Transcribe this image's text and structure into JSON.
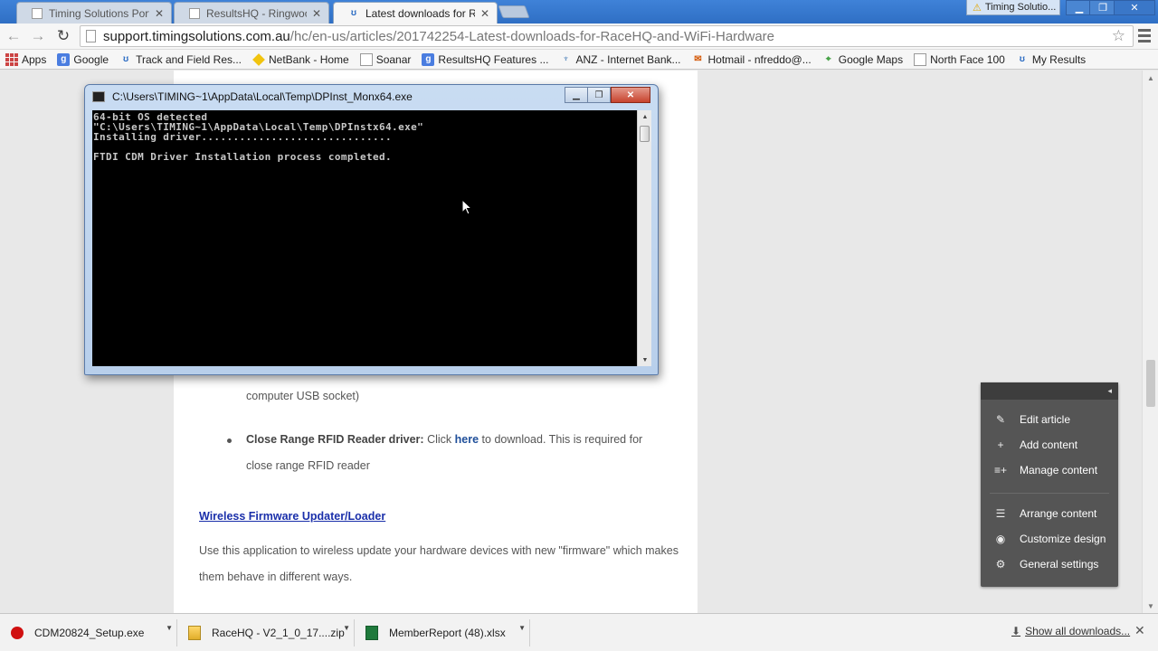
{
  "tabs": [
    {
      "title": "Timing Solutions Portal | L",
      "active": false
    },
    {
      "title": "ResultsHQ - Ringwood LA",
      "active": false
    },
    {
      "title": "Latest downloads for Race",
      "active": true
    }
  ],
  "profile_badge": "Timing Solutio...",
  "window_controls": {
    "minimize": "▁",
    "restore": "❐",
    "close": "✕"
  },
  "toolbar": {
    "url_host": "support.timingsolutions.com.au",
    "url_path": "/hc/en-us/articles/201742254-Latest-downloads-for-RaceHQ-and-WiFi-Hardware"
  },
  "bookmarks": [
    {
      "label": "Apps",
      "icon": "apps-icon"
    },
    {
      "label": "Google",
      "icon": "google-icon"
    },
    {
      "label": "Track and Field Res...",
      "icon": "u-icon"
    },
    {
      "label": "NetBank - Home",
      "icon": "netbank-icon"
    },
    {
      "label": "Soanar",
      "icon": "doc-icon"
    },
    {
      "label": "ResultsHQ Features ...",
      "icon": "google-icon"
    },
    {
      "label": "ANZ - Internet Bank...",
      "icon": "anz-icon"
    },
    {
      "label": "Hotmail - nfreddo@...",
      "icon": "hotmail-icon"
    },
    {
      "label": "Google Maps",
      "icon": "maps-icon"
    },
    {
      "label": "North Face 100",
      "icon": "doc-icon"
    },
    {
      "label": "My Results",
      "icon": "u-icon"
    }
  ],
  "article": {
    "line_usb": "computer USB socket)",
    "rfid_label": "Close Range RFID Reader driver:",
    "rfid_click": "Click",
    "rfid_here": "here",
    "rfid_rest": "to download. This is required for",
    "rfid_line2": "close range RFID reader",
    "wireless_heading": "Wireless Firmware Updater/Loader",
    "wireless_line1": "Use this application to wireless update your hardware devices with new \"firmware\" which makes",
    "wireless_line2": "them behave in different ways."
  },
  "admin_panel": {
    "collapse": "◂",
    "items": [
      {
        "label": "Edit article",
        "icon": "pencil-icon"
      },
      {
        "label": "Add content",
        "icon": "plus-icon"
      },
      {
        "label": "Manage content",
        "icon": "manage-icon"
      },
      {
        "label": "Arrange content",
        "icon": "list-icon"
      },
      {
        "label": "Customize design",
        "icon": "eye-icon"
      },
      {
        "label": "General settings",
        "icon": "gear-icon"
      }
    ]
  },
  "console": {
    "title": "C:\\Users\\TIMING~1\\AppData\\Local\\Temp\\DPInst_Monx64.exe",
    "output": "64-bit OS detected\n\"C:\\Users\\TIMING~1\\AppData\\Local\\Temp\\DPInstx64.exe\"\nInstalling driver..............................\n\nFTDI CDM Driver Installation process completed."
  },
  "downloads": [
    {
      "name": "CDM20824_Setup.exe",
      "type": "exe"
    },
    {
      "name": "RaceHQ - V2_1_0_17....zip",
      "type": "zip"
    },
    {
      "name": "MemberReport (48).xlsx",
      "type": "xlsx"
    }
  ],
  "show_all_downloads": "Show all downloads...",
  "colors": {
    "tab_strip": "#3f82d8",
    "link_heading": "#1a2faa",
    "admin_panel_bg": "#555555",
    "console_bg": "#000000"
  }
}
